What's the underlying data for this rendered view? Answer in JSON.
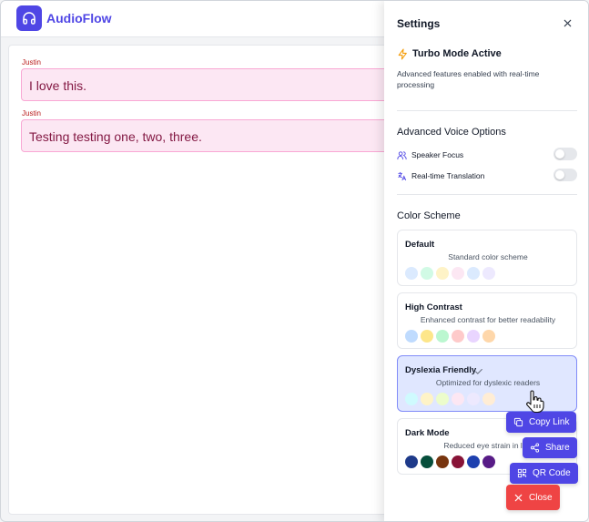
{
  "app": {
    "title": "AudioFlow",
    "logo_icon": "headphones-icon"
  },
  "transcript": {
    "messages": [
      {
        "speaker": "Justin",
        "text": "I love this."
      },
      {
        "speaker": "Justin",
        "text": "Testing testing one, two, three."
      }
    ]
  },
  "settings": {
    "title": "Settings",
    "turbo": {
      "title": "Turbo Mode Active",
      "description": "Advanced features enabled with real-time processing"
    },
    "voice": {
      "title": "Advanced Voice Options",
      "options": [
        {
          "label": "Speaker Focus",
          "icon": "users-icon",
          "enabled": false
        },
        {
          "label": "Real-time Translation",
          "icon": "translate-icon",
          "enabled": false
        }
      ]
    },
    "color_scheme": {
      "title": "Color Scheme",
      "selected": "Dyslexia Friendly",
      "schemes": [
        {
          "name": "Default",
          "description": "Standard color scheme",
          "colors": [
            "#dbeafe",
            "#d1fae5",
            "#fef3c7",
            "#fce7f3",
            "#dbeafe",
            "#ede9fe"
          ]
        },
        {
          "name": "High Contrast",
          "description": "Enhanced contrast for better readability",
          "colors": [
            "#bfdbfe",
            "#fde68a",
            "#bbf7d0",
            "#fecaca",
            "#e9d5ff",
            "#fed7aa"
          ]
        },
        {
          "name": "Dyslexia Friendly",
          "description": "Optimized for dyslexic readers",
          "colors": [
            "#cffafe",
            "#fef3c7",
            "#ecfccb",
            "#fce7f3",
            "#ede9fe",
            "#ffedd5"
          ]
        },
        {
          "name": "Dark Mode",
          "description": "Reduced eye strain in low",
          "colors": [
            "#1e3a8a",
            "#064e3b",
            "#78350f",
            "#881337",
            "#1e40af",
            "#581c87"
          ]
        }
      ]
    }
  },
  "share_menu": {
    "copy_link": "Copy Link",
    "share": "Share",
    "qr_code": "QR Code",
    "close": "Close"
  }
}
